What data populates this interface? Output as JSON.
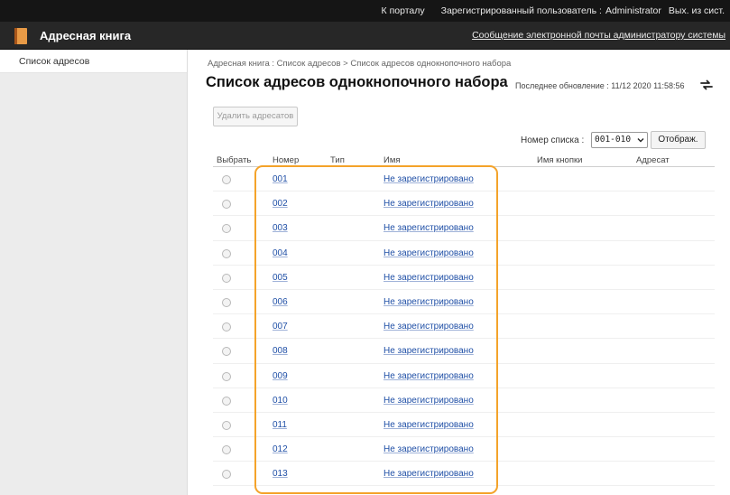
{
  "topbar": {
    "portal_link": "К порталу",
    "user_label": "Зарегистрированный пользователь :",
    "user_name": "Administrator",
    "logout": "Вых. из сист."
  },
  "app": {
    "title": "Адресная книга",
    "admin_mail": "Сообщение электронной почты администратору системы"
  },
  "sidebar": {
    "items": [
      {
        "label": "Список адресов"
      }
    ]
  },
  "main": {
    "breadcrumb": "Адресная книга : Список адресов > Список адресов однокнопочного набора",
    "title": "Список адресов однокнопочного набора",
    "last_update": "Последнее обновление : 11/12 2020 11:58:56",
    "delete_button": "Удалить адресатов",
    "list_number_label": "Номер списка :",
    "list_number_value": "001-010",
    "display_button": "Отображ."
  },
  "table": {
    "headers": {
      "select": "Выбрать",
      "number": "Номер",
      "type": "Тип",
      "name": "Имя",
      "button_name": "Имя кнопки",
      "recipient": "Адресат"
    },
    "rows": [
      {
        "number": "001",
        "name": "Не зарегистрировано"
      },
      {
        "number": "002",
        "name": "Не зарегистрировано"
      },
      {
        "number": "003",
        "name": "Не зарегистрировано"
      },
      {
        "number": "004",
        "name": "Не зарегистрировано"
      },
      {
        "number": "005",
        "name": "Не зарегистрировано"
      },
      {
        "number": "006",
        "name": "Не зарегистрировано"
      },
      {
        "number": "007",
        "name": "Не зарегистрировано"
      },
      {
        "number": "008",
        "name": "Не зарегистрировано"
      },
      {
        "number": "009",
        "name": "Не зарегистрировано"
      },
      {
        "number": "010",
        "name": "Не зарегистрировано"
      },
      {
        "number": "011",
        "name": "Не зарегистрировано"
      },
      {
        "number": "012",
        "name": "Не зарегистрировано"
      },
      {
        "number": "013",
        "name": "Не зарегистрировано"
      }
    ]
  },
  "icons": {
    "app": "address-book-icon",
    "refresh": "refresh-icon",
    "dropdown": "chevron-down-icon"
  },
  "colors": {
    "link": "#1f4fa6",
    "highlight": "#f4a32a",
    "header_bg": "#151515"
  }
}
